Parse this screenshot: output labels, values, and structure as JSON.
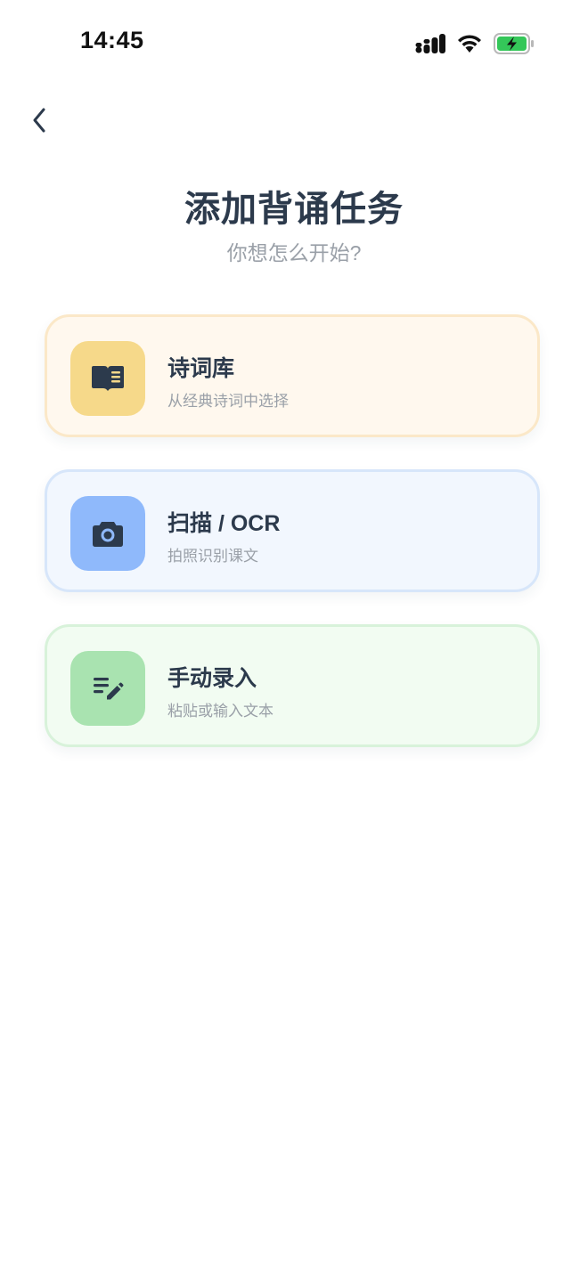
{
  "status_bar": {
    "time": "14:45"
  },
  "header": {
    "title": "添加背诵任务",
    "subtitle": "你想怎么开始?"
  },
  "options": [
    {
      "title": "诗词库",
      "description": "从经典诗词中选择",
      "icon": "book-icon",
      "accent": "#f6d98a"
    },
    {
      "title": "扫描 / OCR",
      "description": "拍照识别课文",
      "icon": "camera-icon",
      "accent": "#8fb9fb"
    },
    {
      "title": "手动录入",
      "description": "粘贴或输入文本",
      "icon": "edit-note-icon",
      "accent": "#a9e3b0"
    }
  ],
  "colors": {
    "text_primary": "#2c3a4c",
    "text_secondary": "#9aa0a8",
    "battery_green": "#34c759"
  }
}
